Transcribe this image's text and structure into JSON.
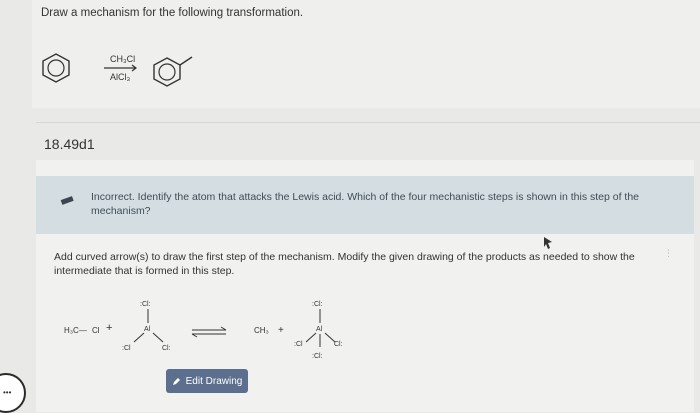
{
  "question": {
    "prompt": "Draw a mechanism for the following transformation.",
    "reagents": {
      "top": "CH₃Cl",
      "bottom": "AlCl₃"
    }
  },
  "item": {
    "label": "18.49d1"
  },
  "feedback": {
    "status": "incorrect",
    "text": "Incorrect. Identify the atom that attacks the Lewis acid. Which of the four mechanistic steps is shown in this step of the mechanism?"
  },
  "step": {
    "instructions": "Add curved arrow(s) to draw the first step of the mechanism. Modify the given drawing of the products as needed to show the intermediate that is formed in this step."
  },
  "drawing": {
    "reactant_methyl": "H₃C—",
    "reactant_cl": "Cl",
    "plus1": "+",
    "al": "Al",
    "cl_top": ":Cl:",
    "cl_left": ":Cl",
    "cl_right": "Cl:",
    "product_methyl": "CH₃",
    "plus2": "+",
    "product_al": "Al",
    "product_cl_top": ":Cl:",
    "product_cl_left": ":Cl",
    "product_cl_right": "Cl:",
    "product_cl_bottom": ":Cl:"
  },
  "actions": {
    "edit_drawing": "Edit Drawing"
  },
  "colors": {
    "feedback_bg": "#d4dde2",
    "button_bg": "#5c6f8f",
    "page_bg": "#e9e9e7"
  },
  "icons": {
    "feedback": "incorrect-pencil-icon",
    "edit": "pencil-icon",
    "badge": "camera-icon"
  }
}
